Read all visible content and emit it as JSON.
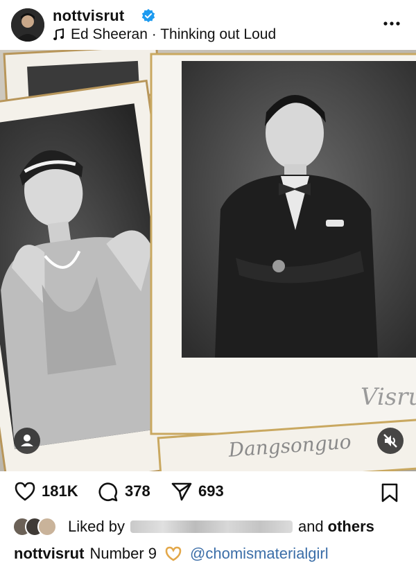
{
  "post": {
    "username": "nottvisrut",
    "verified_icon": "verified-badge-icon",
    "music_track": "Ed Sheeran · Thinking out Loud",
    "more_icon": "more-options-icon"
  },
  "media": {
    "description_icons": [
      "user-tag-icon",
      "mute-icon"
    ],
    "card_signature": "Visrut",
    "card_script_text": "Dangsonguo"
  },
  "actions": {
    "likes": "181K",
    "comments": "378",
    "shares": "693"
  },
  "liked_by": {
    "prefix": "Liked by",
    "suffix": "and",
    "others": "others"
  },
  "caption": {
    "username": "nottvisrut",
    "text": "Number 9",
    "emoji": "heart-hands-emoji",
    "mention": "@chomismaterialgirl"
  },
  "colors": {
    "verified_blue": "#1d9bf0",
    "mention_blue": "#3b6ea8"
  }
}
